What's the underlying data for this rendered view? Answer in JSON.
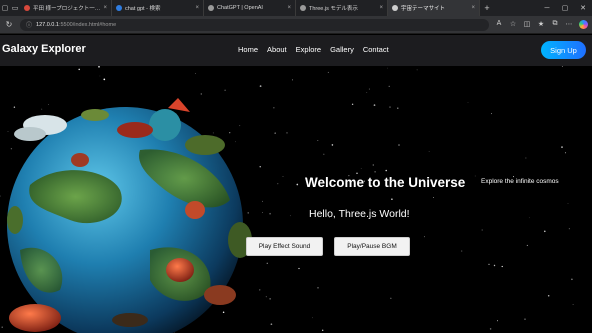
{
  "browser": {
    "tabs": [
      {
        "title": "平田 様ープロジェクト一覧(編集)",
        "favicon_color": "#d9493c",
        "active": false
      },
      {
        "title": "chat gpt - 検索",
        "favicon_color": "#2f7de1",
        "active": false
      },
      {
        "title": "ChatGPT | OpenAI",
        "favicon_color": "#9a9a9a",
        "active": false
      },
      {
        "title": "Three.js モデル表示",
        "favicon_color": "#9a9a9a",
        "active": false
      },
      {
        "title": "宇宙テーマサイト",
        "favicon_color": "#cfcfcf",
        "active": true
      }
    ],
    "url_host": "127.0.0.1",
    "url_path": ":5500/index.html#home"
  },
  "site": {
    "logo": "Galaxy Explorer",
    "menu": [
      "Home",
      "About",
      "Explore",
      "Gallery",
      "Contact"
    ],
    "signup": "Sign Up"
  },
  "hero": {
    "title": "Welcome to the Universe",
    "tagline": "Explore the infinite cosmos",
    "hello": "Hello, Three.js World!",
    "effect_button": "Play Effect Sound",
    "bgm_button": "Play/Pause BGM"
  },
  "colors": {
    "accent": "#1f8bff",
    "page_bg": "#000000",
    "header_bg": "#1e1e22"
  }
}
